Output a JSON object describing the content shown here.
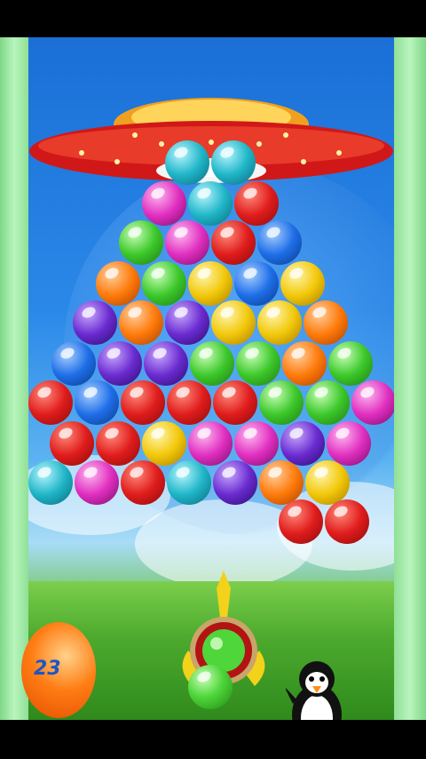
{
  "game": {
    "score_display": "23",
    "next_bubble_color": "green",
    "loaded_bubble_color": "green"
  },
  "colors": {
    "red": "#e01c1c",
    "green": "#3cc82a",
    "blue": "#1e6ee8",
    "cyan": "#1fb6c8",
    "yellow": "#f2c80a",
    "orange": "#ff7a0a",
    "purple": "#6a2bd0",
    "magenta": "#e02fc0"
  },
  "bubble_rows": [
    [
      "cyan",
      "cyan"
    ],
    [
      "magenta",
      "cyan",
      "red"
    ],
    [
      "green",
      "magenta",
      "red",
      "blue"
    ],
    [
      "orange",
      "green",
      "yellow",
      "blue",
      "yellow"
    ],
    [
      "purple",
      "orange",
      "purple",
      "yellow",
      "yellow",
      "orange"
    ],
    [
      "blue",
      "purple",
      "purple",
      "green",
      "green",
      "orange",
      "green"
    ],
    [
      "red",
      "blue",
      "red",
      "red",
      "red",
      "green",
      "green",
      "magenta"
    ],
    [
      "red",
      "red",
      "yellow",
      "magenta",
      "magenta",
      "purple",
      "magenta"
    ],
    [
      "cyan",
      "magenta",
      "red",
      "cyan",
      "purple",
      "orange",
      "yellow"
    ],
    [
      "red",
      "red"
    ]
  ]
}
